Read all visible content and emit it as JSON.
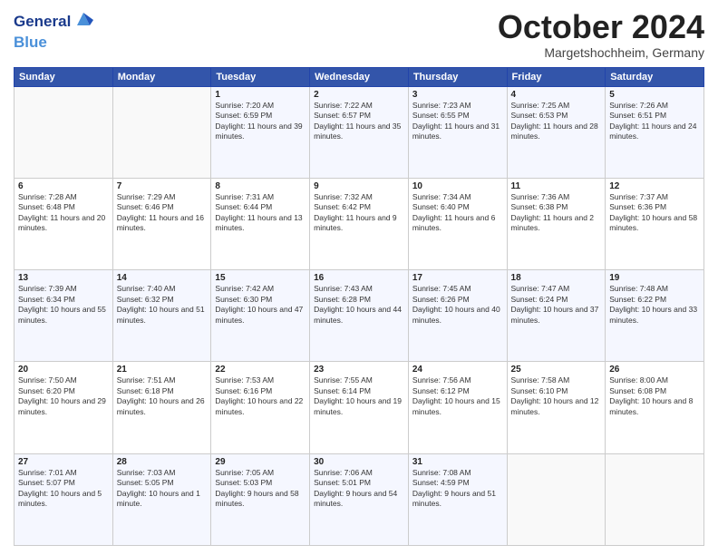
{
  "header": {
    "logo_line1": "General",
    "logo_line2": "Blue",
    "month_title": "October 2024",
    "location": "Margetshochheim, Germany"
  },
  "days_of_week": [
    "Sunday",
    "Monday",
    "Tuesday",
    "Wednesday",
    "Thursday",
    "Friday",
    "Saturday"
  ],
  "weeks": [
    [
      {
        "day": "",
        "info": ""
      },
      {
        "day": "",
        "info": ""
      },
      {
        "day": "1",
        "info": "Sunrise: 7:20 AM\nSunset: 6:59 PM\nDaylight: 11 hours and 39 minutes."
      },
      {
        "day": "2",
        "info": "Sunrise: 7:22 AM\nSunset: 6:57 PM\nDaylight: 11 hours and 35 minutes."
      },
      {
        "day": "3",
        "info": "Sunrise: 7:23 AM\nSunset: 6:55 PM\nDaylight: 11 hours and 31 minutes."
      },
      {
        "day": "4",
        "info": "Sunrise: 7:25 AM\nSunset: 6:53 PM\nDaylight: 11 hours and 28 minutes."
      },
      {
        "day": "5",
        "info": "Sunrise: 7:26 AM\nSunset: 6:51 PM\nDaylight: 11 hours and 24 minutes."
      }
    ],
    [
      {
        "day": "6",
        "info": "Sunrise: 7:28 AM\nSunset: 6:48 PM\nDaylight: 11 hours and 20 minutes."
      },
      {
        "day": "7",
        "info": "Sunrise: 7:29 AM\nSunset: 6:46 PM\nDaylight: 11 hours and 16 minutes."
      },
      {
        "day": "8",
        "info": "Sunrise: 7:31 AM\nSunset: 6:44 PM\nDaylight: 11 hours and 13 minutes."
      },
      {
        "day": "9",
        "info": "Sunrise: 7:32 AM\nSunset: 6:42 PM\nDaylight: 11 hours and 9 minutes."
      },
      {
        "day": "10",
        "info": "Sunrise: 7:34 AM\nSunset: 6:40 PM\nDaylight: 11 hours and 6 minutes."
      },
      {
        "day": "11",
        "info": "Sunrise: 7:36 AM\nSunset: 6:38 PM\nDaylight: 11 hours and 2 minutes."
      },
      {
        "day": "12",
        "info": "Sunrise: 7:37 AM\nSunset: 6:36 PM\nDaylight: 10 hours and 58 minutes."
      }
    ],
    [
      {
        "day": "13",
        "info": "Sunrise: 7:39 AM\nSunset: 6:34 PM\nDaylight: 10 hours and 55 minutes."
      },
      {
        "day": "14",
        "info": "Sunrise: 7:40 AM\nSunset: 6:32 PM\nDaylight: 10 hours and 51 minutes."
      },
      {
        "day": "15",
        "info": "Sunrise: 7:42 AM\nSunset: 6:30 PM\nDaylight: 10 hours and 47 minutes."
      },
      {
        "day": "16",
        "info": "Sunrise: 7:43 AM\nSunset: 6:28 PM\nDaylight: 10 hours and 44 minutes."
      },
      {
        "day": "17",
        "info": "Sunrise: 7:45 AM\nSunset: 6:26 PM\nDaylight: 10 hours and 40 minutes."
      },
      {
        "day": "18",
        "info": "Sunrise: 7:47 AM\nSunset: 6:24 PM\nDaylight: 10 hours and 37 minutes."
      },
      {
        "day": "19",
        "info": "Sunrise: 7:48 AM\nSunset: 6:22 PM\nDaylight: 10 hours and 33 minutes."
      }
    ],
    [
      {
        "day": "20",
        "info": "Sunrise: 7:50 AM\nSunset: 6:20 PM\nDaylight: 10 hours and 29 minutes."
      },
      {
        "day": "21",
        "info": "Sunrise: 7:51 AM\nSunset: 6:18 PM\nDaylight: 10 hours and 26 minutes."
      },
      {
        "day": "22",
        "info": "Sunrise: 7:53 AM\nSunset: 6:16 PM\nDaylight: 10 hours and 22 minutes."
      },
      {
        "day": "23",
        "info": "Sunrise: 7:55 AM\nSunset: 6:14 PM\nDaylight: 10 hours and 19 minutes."
      },
      {
        "day": "24",
        "info": "Sunrise: 7:56 AM\nSunset: 6:12 PM\nDaylight: 10 hours and 15 minutes."
      },
      {
        "day": "25",
        "info": "Sunrise: 7:58 AM\nSunset: 6:10 PM\nDaylight: 10 hours and 12 minutes."
      },
      {
        "day": "26",
        "info": "Sunrise: 8:00 AM\nSunset: 6:08 PM\nDaylight: 10 hours and 8 minutes."
      }
    ],
    [
      {
        "day": "27",
        "info": "Sunrise: 7:01 AM\nSunset: 5:07 PM\nDaylight: 10 hours and 5 minutes."
      },
      {
        "day": "28",
        "info": "Sunrise: 7:03 AM\nSunset: 5:05 PM\nDaylight: 10 hours and 1 minute."
      },
      {
        "day": "29",
        "info": "Sunrise: 7:05 AM\nSunset: 5:03 PM\nDaylight: 9 hours and 58 minutes."
      },
      {
        "day": "30",
        "info": "Sunrise: 7:06 AM\nSunset: 5:01 PM\nDaylight: 9 hours and 54 minutes."
      },
      {
        "day": "31",
        "info": "Sunrise: 7:08 AM\nSunset: 4:59 PM\nDaylight: 9 hours and 51 minutes."
      },
      {
        "day": "",
        "info": ""
      },
      {
        "day": "",
        "info": ""
      }
    ]
  ]
}
